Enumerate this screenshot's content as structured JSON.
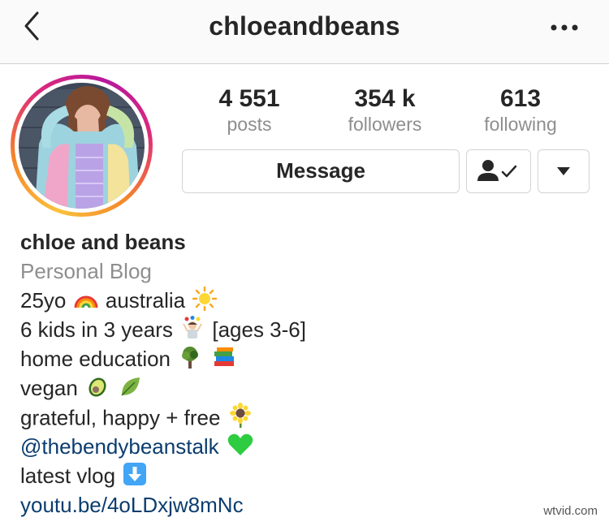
{
  "header": {
    "title": "chloeandbeans",
    "more_label": "•••"
  },
  "stats": [
    {
      "value": "4 551",
      "label": "posts"
    },
    {
      "value": "354 k",
      "label": "followers"
    },
    {
      "value": "613",
      "label": "following"
    }
  ],
  "actions": {
    "message_label": "Message",
    "following_icon": "person-check-icon",
    "dropdown_icon": "caret-down-icon"
  },
  "profile": {
    "name": "chloe and beans",
    "category": "Personal Blog",
    "bio": [
      {
        "text": "25yo",
        "emoji": "rainbow-icon",
        "after": "australia",
        "emoji2": "sun-icon"
      },
      {
        "text": "6 kids in 3 years",
        "emoji": "baby-juggling-icon",
        "after": "[ages 3-6]"
      },
      {
        "text": "home education",
        "emoji": "tree-icon",
        "emoji2": "books-icon"
      },
      {
        "text": "vegan",
        "emoji": "avocado-icon",
        "emoji2": "leaf-icon"
      },
      {
        "text": "grateful, happy + free",
        "emoji": "sunflower-icon"
      }
    ],
    "mention": "@thebendybeanstalk",
    "mention_emoji": "green-heart-icon",
    "vlog_text": "latest vlog",
    "vlog_emoji": "down-arrow-icon",
    "link": "youtu.be/4oLDxjw8mNc"
  },
  "watermark": "wtvid.com",
  "colors": {
    "text": "#262626",
    "muted": "#8e8e8e",
    "link": "#0b3d6e",
    "border": "#d4d4d4"
  }
}
